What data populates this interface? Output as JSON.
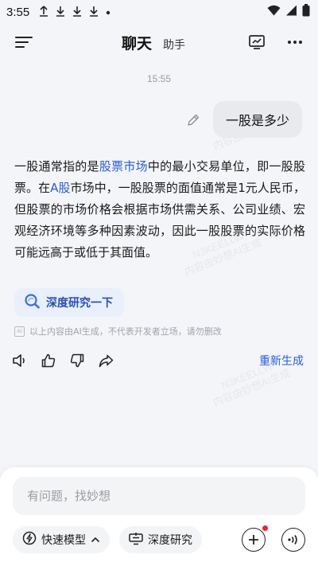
{
  "status_bar": {
    "time": "3:55",
    "notification_icons": [
      "upload-icon",
      "download-icon",
      "download-icon",
      "download-icon",
      "dot-icon"
    ]
  },
  "header": {
    "title": "聊天",
    "subtitle": "助手"
  },
  "timestamp": "15:55",
  "user_message": "一股是多少",
  "answer": {
    "part1": "一股通常指的是",
    "link1": "股票市场",
    "part2": "中的最小交易单位，即一股股票。在",
    "link2": "A股",
    "part3": "市场中，一股股票的面值通常是1元人民币，但股票的市场价格会根据市场供需关系、公司业绩、宏观经济环境等多种因素波动，因此一股股票的实际价格可能远高于或低于其面值。"
  },
  "deep_research_chip": "深度研究一下",
  "disclaimer": {
    "badge": "AI",
    "text": "以上内容由AI生成，不代表开发者立场，请勿删改"
  },
  "actions": {
    "regenerate": "重新生成"
  },
  "watermark": {
    "line1": "N3KEELLW",
    "line2": "内容由妙想AI生成"
  },
  "input": {
    "placeholder": "有问题，找妙想"
  },
  "toolbar": {
    "fast_model": "快速模型",
    "deep_research": "深度研究"
  },
  "colors": {
    "accent": "#2a5bd7",
    "chip_bg": "#e9f0fc",
    "notification_dot": "#e8262b"
  }
}
